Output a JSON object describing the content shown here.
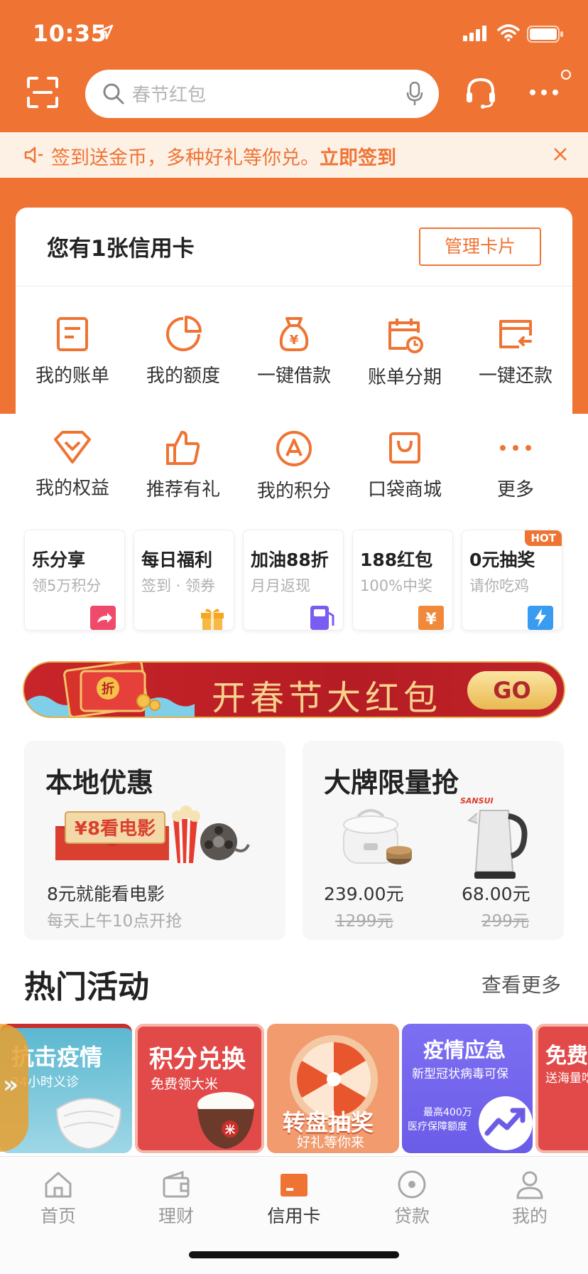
{
  "status": {
    "time": "10:35"
  },
  "search": {
    "placeholder": "春节红包"
  },
  "notice": {
    "text": "签到送金币，多种好礼等你兑。",
    "action": "立即签到"
  },
  "card": {
    "title": "您有1张信用卡",
    "manage_label": "管理卡片",
    "row1": [
      {
        "label": "我的账单",
        "icon": "bill-icon"
      },
      {
        "label": "我的额度",
        "icon": "pie-chart-icon"
      },
      {
        "label": "一键借款",
        "icon": "money-bag-icon"
      },
      {
        "label": "账单分期",
        "icon": "calendar-clock-icon"
      },
      {
        "label": "一键还款",
        "icon": "card-return-icon"
      }
    ],
    "row2": [
      {
        "label": "我的权益",
        "icon": "diamond-icon"
      },
      {
        "label": "推荐有礼",
        "icon": "thumbs-up-icon"
      },
      {
        "label": "我的积分",
        "icon": "points-icon"
      },
      {
        "label": "口袋商城",
        "icon": "shopping-bag-icon"
      },
      {
        "label": "更多",
        "icon": "more-dots-icon"
      }
    ]
  },
  "tiles": [
    {
      "title": "乐分享",
      "sub": "领5万积分",
      "icon": "share-icon",
      "color": "#f04a6a"
    },
    {
      "title": "每日福利",
      "sub": "签到 · 领券",
      "icon": "gift-icon",
      "color": "#f5a623"
    },
    {
      "title": "加油88折",
      "sub": "月月返现",
      "icon": "fuel-icon",
      "color": "#7a5cf0"
    },
    {
      "title": "188红包",
      "sub": "100%中奖",
      "icon": "red-packet-icon",
      "color": "#f08a3a"
    },
    {
      "title": "0元抽奖",
      "sub": "请你吃鸡",
      "icon": "lightning-icon",
      "color": "#3a9cf0",
      "badge": "HOT"
    }
  ],
  "banner": {
    "text": "开春节大红包",
    "go": "GO",
    "coin": "折"
  },
  "local": {
    "title": "本地优惠",
    "ticket": "¥8看电影",
    "line1": "8元就能看电影",
    "line2": "每天上午10点开抢"
  },
  "brand": {
    "title": "大牌限量抢",
    "logo": "SANSUI",
    "items": [
      {
        "price": "239.00元",
        "old": "1299元",
        "icon": "rice-cooker-icon"
      },
      {
        "price": "68.00元",
        "old": "299元",
        "icon": "kettle-icon"
      }
    ]
  },
  "hot": {
    "title": "热门活动",
    "more": "查看更多",
    "events": [
      {
        "title": "抗击疫情",
        "sub": "24小时义诊"
      },
      {
        "title": "积分兑换",
        "sub": "免费领大米"
      },
      {
        "title": "转盘抽奖",
        "sub": "好礼等你来"
      },
      {
        "title": "疫情应急",
        "sub": "新型冠状病毒可保",
        "sub2": "最高400万",
        "sub3": "医疗保障额度"
      },
      {
        "title": "免费",
        "sub": "送海量吃"
      }
    ]
  },
  "tabs": [
    {
      "label": "首页",
      "icon": "home-icon"
    },
    {
      "label": "理财",
      "icon": "wallet-icon"
    },
    {
      "label": "信用卡",
      "icon": "credit-card-icon"
    },
    {
      "label": "贷款",
      "icon": "loan-icon"
    },
    {
      "label": "我的",
      "icon": "profile-icon"
    }
  ],
  "colors": {
    "accent": "#ef7434",
    "notice_bg": "#fdf1e6"
  }
}
